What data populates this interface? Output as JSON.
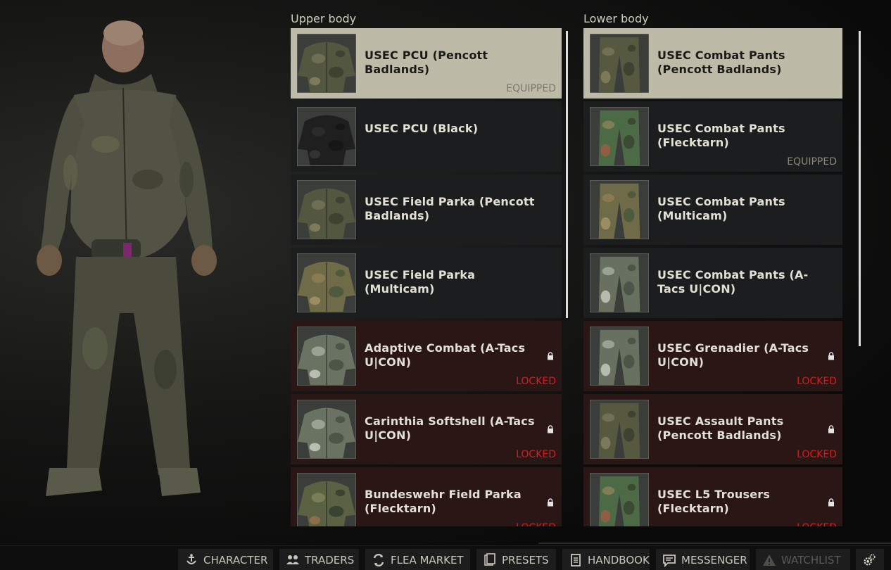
{
  "upper_body": {
    "title": "Upper body",
    "items": [
      {
        "name": "USEC PCU (Pencott Badlands)",
        "status": "EQUIPPED",
        "state": "selected",
        "thumb": "jacket-camo"
      },
      {
        "name": "USEC PCU (Black)",
        "status": "",
        "state": "normal",
        "thumb": "jacket-black"
      },
      {
        "name": "USEC Field Parka (Pencott Badlands)",
        "status": "",
        "state": "normal",
        "thumb": "jacket-camo"
      },
      {
        "name": "USEC Field Parka (Multicam)",
        "status": "",
        "state": "normal",
        "thumb": "jacket-multicam"
      },
      {
        "name": "Adaptive Combat (A-Tacs U|CON)",
        "status": "LOCKED",
        "state": "locked",
        "thumb": "jacket-atacs"
      },
      {
        "name": "Carinthia Softshell (A-Tacs U|CON)",
        "status": "LOCKED",
        "state": "locked",
        "thumb": "jacket-atacs"
      },
      {
        "name": "Bundeswehr Field Parka (Flecktarn)",
        "status": "LOCKED",
        "state": "locked",
        "thumb": "jacket-fleck"
      }
    ]
  },
  "lower_body": {
    "title": "Lower body",
    "items": [
      {
        "name": "USEC Combat Pants (Pencott Badlands)",
        "status": "",
        "state": "selected",
        "thumb": "pants-camo"
      },
      {
        "name": "USEC Combat Pants (Flecktarn)",
        "status": "EQUIPPED",
        "state": "normal",
        "thumb": "pants-fleck"
      },
      {
        "name": "USEC Combat Pants (Multicam)",
        "status": "",
        "state": "normal",
        "thumb": "pants-multicam"
      },
      {
        "name": "USEC Combat Pants (A-Tacs U|CON)",
        "status": "",
        "state": "normal",
        "thumb": "pants-atacs"
      },
      {
        "name": "USEC Grenadier (A-Tacs U|CON)",
        "status": "LOCKED",
        "state": "locked",
        "thumb": "pants-atacs"
      },
      {
        "name": "USEC Assault Pants (Pencott Badlands)",
        "status": "LOCKED",
        "state": "locked",
        "thumb": "pants-camo"
      },
      {
        "name": "USEC L5 Trousers (Flecktarn)",
        "status": "LOCKED",
        "state": "locked",
        "thumb": "pants-fleck"
      }
    ]
  },
  "navbar": {
    "items": [
      {
        "label": "CHARACTER",
        "icon": "character-icon",
        "enabled": true
      },
      {
        "label": "TRADERS",
        "icon": "traders-icon",
        "enabled": true
      },
      {
        "label": "FLEA MARKET",
        "icon": "flea-market-icon",
        "enabled": true
      },
      {
        "label": "PRESETS",
        "icon": "presets-icon",
        "enabled": true
      },
      {
        "label": "HANDBOOK",
        "icon": "handbook-icon",
        "enabled": true
      },
      {
        "label": "MESSENGER",
        "icon": "messenger-icon",
        "enabled": true
      },
      {
        "label": "WATCHLIST",
        "icon": "warning-icon",
        "enabled": false
      }
    ],
    "settings_icon": "gear-icon"
  },
  "colors": {
    "selected_bg": "#bdbaa7",
    "item_bg": "#1c1d1f",
    "locked_bg": "#2b1616",
    "locked_text": "#d21e1e",
    "equipped_text": "#8a877a"
  }
}
